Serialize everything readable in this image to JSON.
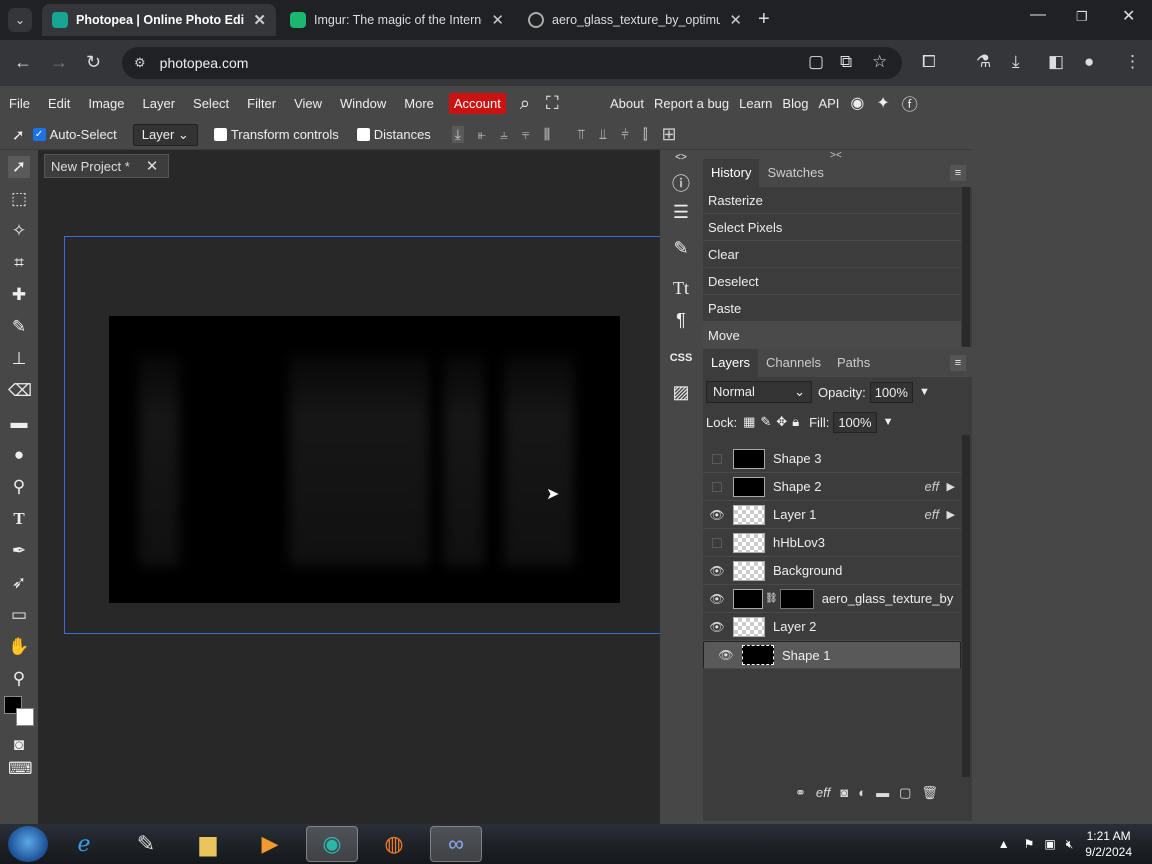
{
  "browser": {
    "tabs": [
      {
        "title": "Photopea | Online Photo Editor",
        "active": true
      },
      {
        "title": "Imgur: The magic of the Internet",
        "active": false
      },
      {
        "title": "aero_glass_texture_by_optimum",
        "active": false
      }
    ],
    "new_tab": "+",
    "url": "photopea.com",
    "window_controls": {
      "minimize": "—",
      "maximize": "❐",
      "close": "✕"
    }
  },
  "menu": {
    "items": [
      "File",
      "Edit",
      "Image",
      "Layer",
      "Select",
      "Filter",
      "View",
      "Window",
      "More"
    ],
    "account": "Account",
    "right_items": [
      "About",
      "Report a bug",
      "Learn",
      "Blog",
      "API"
    ]
  },
  "options": {
    "auto_select_label": "Auto-Select",
    "auto_select_checked": true,
    "target": "Layer",
    "transform_controls": "Transform controls",
    "distances": "Distances"
  },
  "document": {
    "tab_title": "New Project *"
  },
  "history": {
    "tabs": [
      "History",
      "Swatches"
    ],
    "items": [
      "Rasterize",
      "Select Pixels",
      "Clear",
      "Deselect",
      "Paste",
      "Move"
    ]
  },
  "layers": {
    "tabs": [
      "Layers",
      "Channels",
      "Paths"
    ],
    "blend_mode": "Normal",
    "opacity_label": "Opacity:",
    "opacity": "100%",
    "lock_label": "Lock:",
    "fill_label": "Fill:",
    "fill": "100%",
    "fx_label": "eff",
    "list": [
      {
        "name": "Shape 3",
        "visible": false,
        "fx": false
      },
      {
        "name": "Shape 2",
        "visible": false,
        "fx": true
      },
      {
        "name": "Layer 1",
        "visible": true,
        "fx": true
      },
      {
        "name": "hHbLov3",
        "visible": false,
        "fx": false
      },
      {
        "name": "Background",
        "visible": true,
        "fx": false
      },
      {
        "name": "aero_glass_texture_by",
        "visible": true,
        "fx": false
      },
      {
        "name": "Layer 2",
        "visible": true,
        "fx": false
      },
      {
        "name": "Shape 1",
        "visible": true,
        "fx": false
      }
    ]
  },
  "taskbar": {
    "time": "1:21 AM",
    "date": "9/2/2024"
  },
  "colors": {
    "accent": "#cc1111",
    "canvas_border": "#3e6bd8"
  }
}
